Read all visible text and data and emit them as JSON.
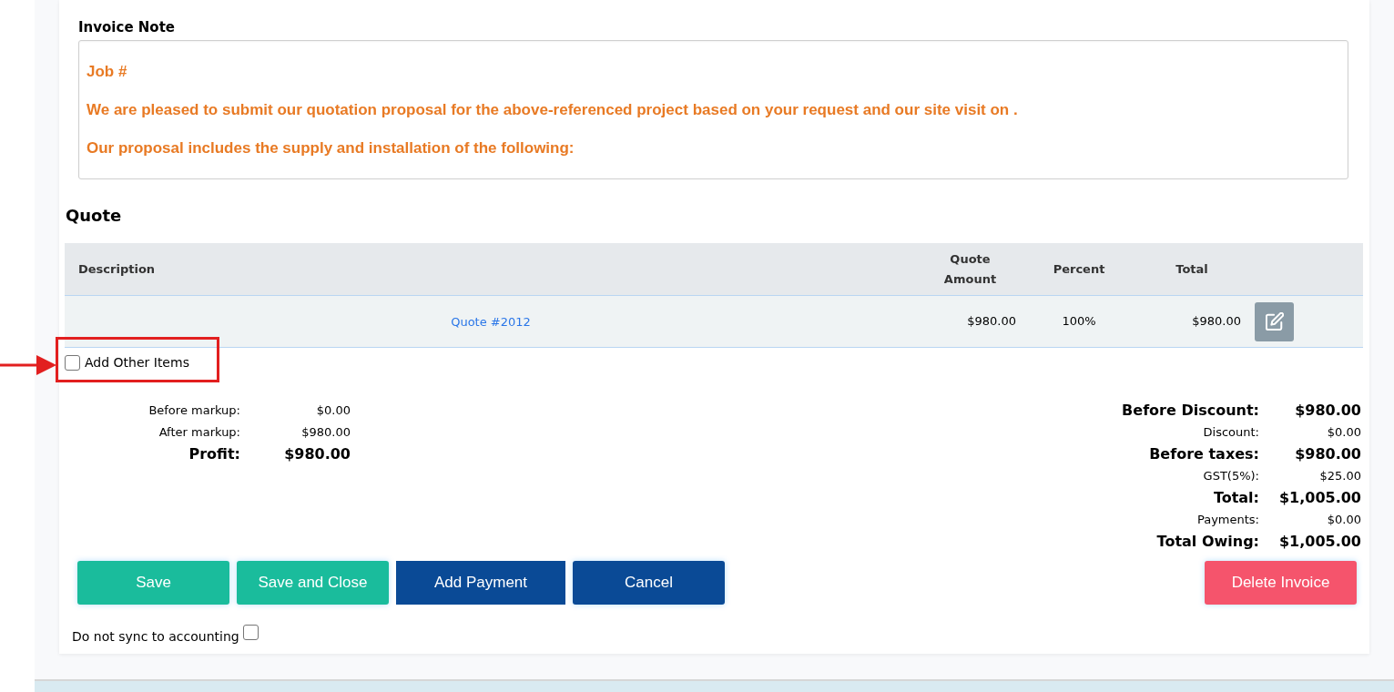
{
  "invoice_note": {
    "label": "Invoice Note",
    "lines": [
      "Job #",
      "We are pleased to submit our quotation proposal for the above-referenced project based on your request and our site visit on .",
      "Our proposal includes the supply and installation of the following:"
    ]
  },
  "quote": {
    "title": "Quote",
    "columns": [
      {
        "label": "Description"
      },
      {
        "label": "Quote Amount"
      },
      {
        "label": "Percent"
      },
      {
        "label": "Total"
      }
    ],
    "rows": [
      {
        "description": "Quote #2012",
        "quote_amount": "$980.00",
        "percent": "100%",
        "total": "$980.00"
      }
    ]
  },
  "add_other_items": {
    "label": "Add Other Items",
    "checked": false
  },
  "markup_summary": [
    {
      "label": "Before markup:",
      "value": "$0.00",
      "kind": "minor"
    },
    {
      "label": "After markup:",
      "value": "$980.00",
      "kind": "minor"
    },
    {
      "label": "Profit:",
      "value": "$980.00",
      "kind": "major"
    }
  ],
  "totals": [
    {
      "label": "Before Discount:",
      "value": "$980.00",
      "kind": "major"
    },
    {
      "label": "Discount:",
      "value": "$0.00",
      "kind": "minor"
    },
    {
      "label": "Before taxes:",
      "value": "$980.00",
      "kind": "major"
    },
    {
      "label": "GST(5%):",
      "value": "$25.00",
      "kind": "minor"
    },
    {
      "label": "Total:",
      "value": "$1,005.00",
      "kind": "major"
    },
    {
      "label": "Payments:",
      "value": "$0.00",
      "kind": "minor"
    },
    {
      "label": "Total Owing:",
      "value": "$1,005.00",
      "kind": "major"
    }
  ],
  "actions": [
    {
      "label": "Save",
      "kind": "success"
    },
    {
      "label": "Save and Close",
      "kind": "success"
    },
    {
      "label": "Add Payment",
      "kind": "primary"
    },
    {
      "label": "Cancel",
      "kind": "secondary"
    }
  ],
  "delete_button": {
    "label": "Delete Invoice",
    "kind": "danger"
  },
  "sync": {
    "label": "Do not sync to accounting",
    "checked": false
  }
}
